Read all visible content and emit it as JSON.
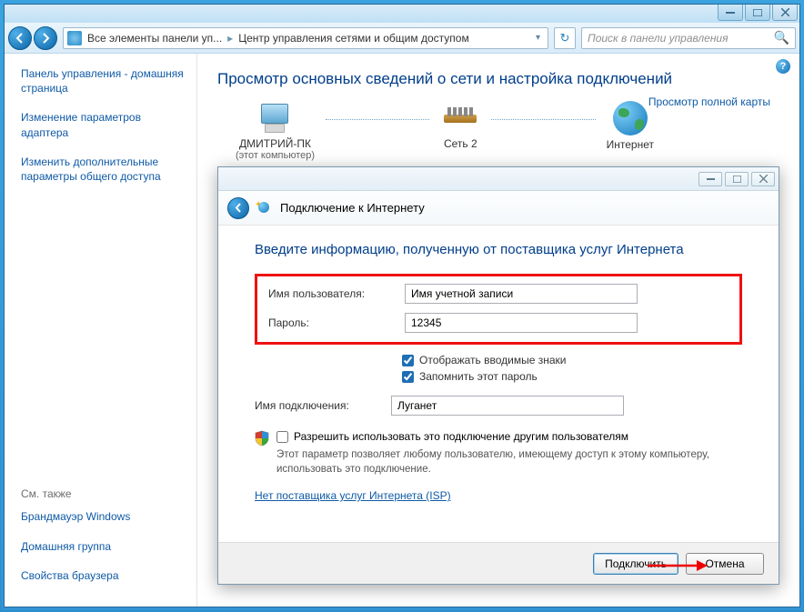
{
  "address": {
    "crumb1": "Все элементы панели уп...",
    "crumb2": "Центр управления сетями и общим доступом"
  },
  "search": {
    "placeholder": "Поиск в панели управления"
  },
  "sidebar": {
    "home": "Панель управления - домашняя страница",
    "link1": "Изменение параметров адаптера",
    "link2": "Изменить дополнительные параметры общего доступа",
    "see_also_label": "См. также",
    "also1": "Брандмауэр Windows",
    "also2": "Домашняя группа",
    "also3": "Свойства браузера"
  },
  "content": {
    "heading": "Просмотр основных сведений о сети и настройка подключений",
    "node1": "ДМИТРИЙ-ПК",
    "node1_sub": "(этот компьютер)",
    "node2": "Сеть 2",
    "node3": "Интернет",
    "full_map": "Просмотр полной карты"
  },
  "dialog": {
    "title": "Подключение к Интернету",
    "heading": "Введите информацию, полученную от поставщика услуг Интернета",
    "user_label": "Имя пользователя:",
    "user_value": "Имя учетной записи",
    "pass_label": "Пароль:",
    "pass_value": "12345",
    "show_chars": "Отображать вводимые знаки",
    "remember": "Запомнить этот пароль",
    "conn_label": "Имя подключения:",
    "conn_value": "Луганет",
    "allow_others": "Разрешить использовать это подключение другим пользователям",
    "allow_hint": "Этот параметр позволяет любому пользователю, имеющему доступ к этому компьютеру, использовать это подключение.",
    "isp_link": "Нет поставщика услуг Интернета (ISP)",
    "connect": "Подключить",
    "cancel": "Отмена"
  }
}
